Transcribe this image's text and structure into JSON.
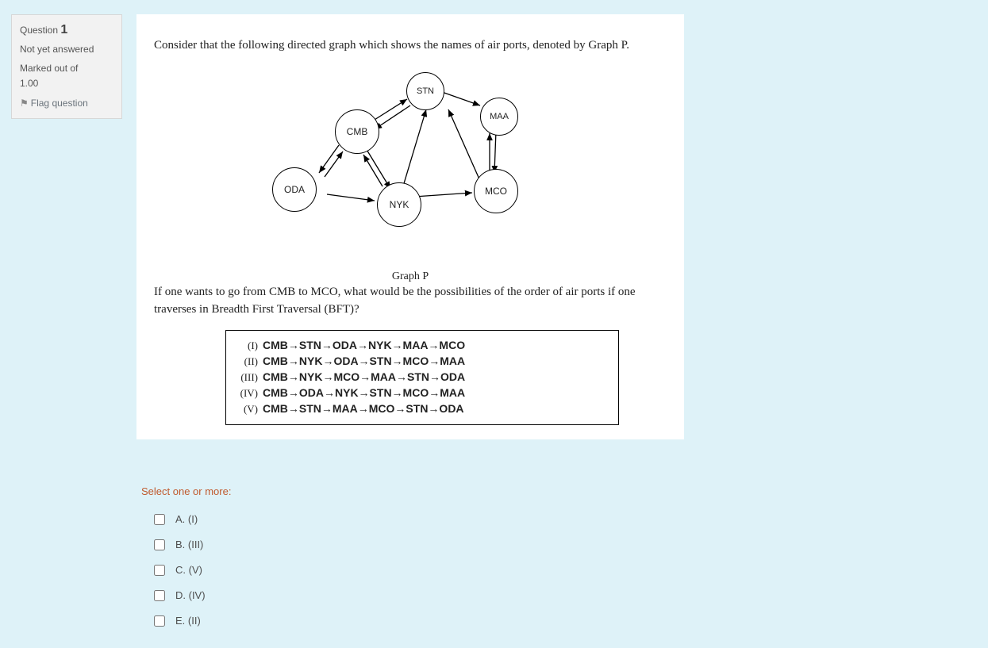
{
  "info": {
    "question_label": "Question",
    "question_number": "1",
    "status": "Not yet answered",
    "marked_out_of_label": "Marked out of",
    "marked_out_of_value": "1.00",
    "flag_label": "Flag question"
  },
  "question": {
    "intro": "Consider that the following directed graph which shows the names of air ports, denoted by Graph P.",
    "graph_caption": "Graph P",
    "nodes": {
      "stn": "STN",
      "maa": "MAA",
      "cmb": "CMB",
      "oda": "ODA",
      "nyk": "NYK",
      "mco": "MCO"
    },
    "followup": "If one wants to go from CMB to MCO, what would be the possibilities of the order of air ports if one traverses in Breadth First Traversal (BFT)?",
    "paths": [
      {
        "num": "(I)",
        "seq": "CMB→STN→ODA→NYK→MAA→MCO"
      },
      {
        "num": "(II)",
        "seq": "CMB→NYK→ODA→STN→MCO→MAA"
      },
      {
        "num": "(III)",
        "seq": "CMB→NYK→MCO→MAA→STN→ODA"
      },
      {
        "num": "(IV)",
        "seq": "CMB→ODA→NYK→STN→MCO→MAA"
      },
      {
        "num": "(V)",
        "seq": "CMB→STN→MAA→MCO→STN→ODA"
      }
    ]
  },
  "answers": {
    "prompt": "Select one or more:",
    "options": [
      {
        "key": "A",
        "label": "A. (I)"
      },
      {
        "key": "B",
        "label": "B. (III)"
      },
      {
        "key": "C",
        "label": "C. (V)"
      },
      {
        "key": "D",
        "label": "D. (IV)"
      },
      {
        "key": "E",
        "label": "E. (II)"
      }
    ]
  }
}
